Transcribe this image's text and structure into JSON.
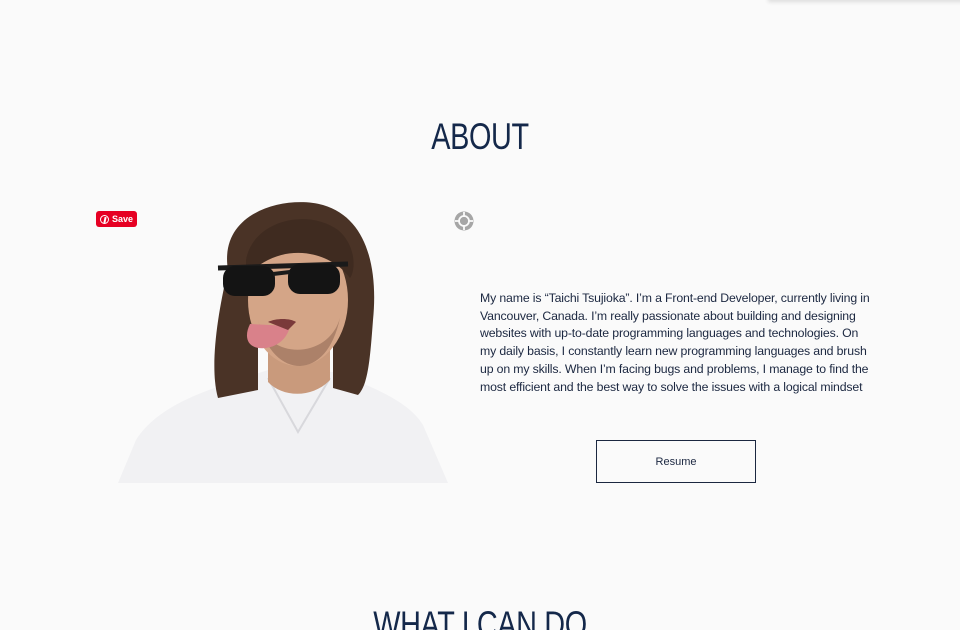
{
  "about": {
    "title": "ABOUT",
    "pin_save_label": "Save",
    "bio": "My name is “Taichi Tsujioka”. I’m a Front-end Developer, currently living in Vancouver, Canada. I’m really passionate about building and designing websites with up-to-date programming languages and technologies. On my daily basis, I constantly learn new programming languages and brush up on my skills. When I’m facing bugs and problems, I manage to find the most efficient and the best way to solve the issues with a logical mindset",
    "resume_label": "Resume"
  },
  "next_section": {
    "title": "WHAT I CAN DO"
  },
  "icons": {
    "pin": "pinterest-icon",
    "scan": "scan-target-icon"
  },
  "colors": {
    "background": "#fafafa",
    "heading": "#14284a",
    "text": "#1b2740",
    "pinterest": "#e60023"
  }
}
